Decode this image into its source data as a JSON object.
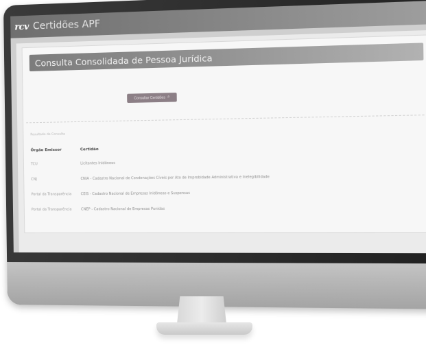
{
  "app": {
    "logo": "rcv",
    "title": "Certidões APF"
  },
  "panel": {
    "title": "Consulta Consolidada de Pessoa Jurídica",
    "query_button_label": "Consultar Certidões"
  },
  "results": {
    "section_label": "Resultado da Consulta",
    "columns": [
      "Órgão Emissor",
      "Certidão"
    ],
    "rows": [
      [
        "TCU",
        "Licitantes Inidôneos"
      ],
      [
        "CNJ",
        "CNIA - Cadastro Nacional de Condenações Cíveis por Ato de Improbidade Administrativa e Inelegibilidade"
      ],
      [
        "Portal da Transparência",
        "CEIS - Cadastro Nacional de Empresas Inidôneas e Suspensas"
      ],
      [
        "Portal da Transparência",
        "CNEP - Cadastro Nacional de Empresas Punidas"
      ]
    ]
  },
  "colors": {
    "header_gray": "#7f7f7f",
    "button_mauve": "#8c7f86",
    "monitor_bezel": "#2e2e2e"
  },
  "icons": {
    "query_button": "search-icon"
  }
}
